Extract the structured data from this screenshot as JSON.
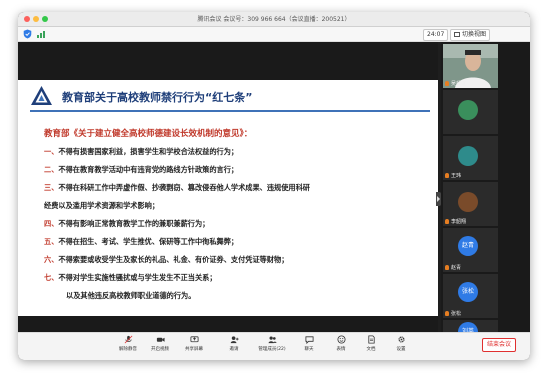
{
  "window": {
    "title": "腾讯会议 会议号：309 966 664（会议直播：200521）"
  },
  "topbar": {
    "timer": "24:07",
    "view_button": "切换视图"
  },
  "slide": {
    "title": "教育部关于高校教师禁行行为“红七条”",
    "subtitle": "教育部《关于建立健全高校师德建设长效机制的意见》：",
    "items": [
      {
        "num": "一、",
        "text": "不得有损害国家利益，损害学生和学校合法权益的行为；"
      },
      {
        "num": "二、",
        "text": "不得在教育教学活动中有违背党的路线方针政策的言行；"
      },
      {
        "num": "三、",
        "text": "不得在科研工作中弄虚作假、抄袭剽窃、篡改侵吞他人学术成果、违规使用科研"
      },
      {
        "num": "",
        "text": "经费以及滥用学术资源和学术影响；"
      },
      {
        "num": "四、",
        "text": "不得有影响正常教育教学工作的兼职兼薪行为；"
      },
      {
        "num": "五、",
        "text": "不得在招生、考试、学生推优、保研等工作中徇私舞弊；"
      },
      {
        "num": "六、",
        "text": "不得索要或收受学生及家长的礼品、礼金、有价证券、支付凭证等财物；"
      },
      {
        "num": "七、",
        "text": "不得对学生实施性骚扰或与学生发生不正当关系；"
      },
      {
        "num": "",
        "text": "以及其他违反高校教师职业道德的行为。"
      }
    ]
  },
  "participants": [
    {
      "name": "吴颉雄",
      "kind": "video"
    },
    {
      "name": "",
      "kind": "avatar",
      "color": "#3a8f5c"
    },
    {
      "name": "王玮",
      "kind": "avatar",
      "color": "#2e8b8b"
    },
    {
      "name": "李韶翔",
      "kind": "avatar",
      "color": "#7a4b2a"
    },
    {
      "name": "赵青",
      "kind": "text",
      "initials": "赵青"
    },
    {
      "name": "张松",
      "kind": "text",
      "initials": "张松"
    },
    {
      "name": "",
      "kind": "text",
      "initials": "刘英"
    }
  ],
  "toolbar": {
    "items": [
      {
        "label": "解除静音",
        "icon": "mic-muted-icon"
      },
      {
        "label": "开启视频",
        "icon": "camera-icon"
      },
      {
        "label": "共享屏幕",
        "icon": "share-screen-icon"
      },
      {
        "label": "邀请",
        "icon": "invite-icon"
      },
      {
        "label": "管理成员(22)",
        "icon": "members-icon"
      },
      {
        "label": "聊天",
        "icon": "chat-icon"
      },
      {
        "label": "表情",
        "icon": "emoji-icon"
      },
      {
        "label": "文档",
        "icon": "document-icon"
      },
      {
        "label": "设置",
        "icon": "settings-icon"
      }
    ],
    "end_button": "结束会议"
  },
  "colors": {
    "accent_red": "#c0392b",
    "title_blue": "#1f3f7a",
    "rule_blue": "#3f72b8",
    "end_red": "#e03030"
  }
}
